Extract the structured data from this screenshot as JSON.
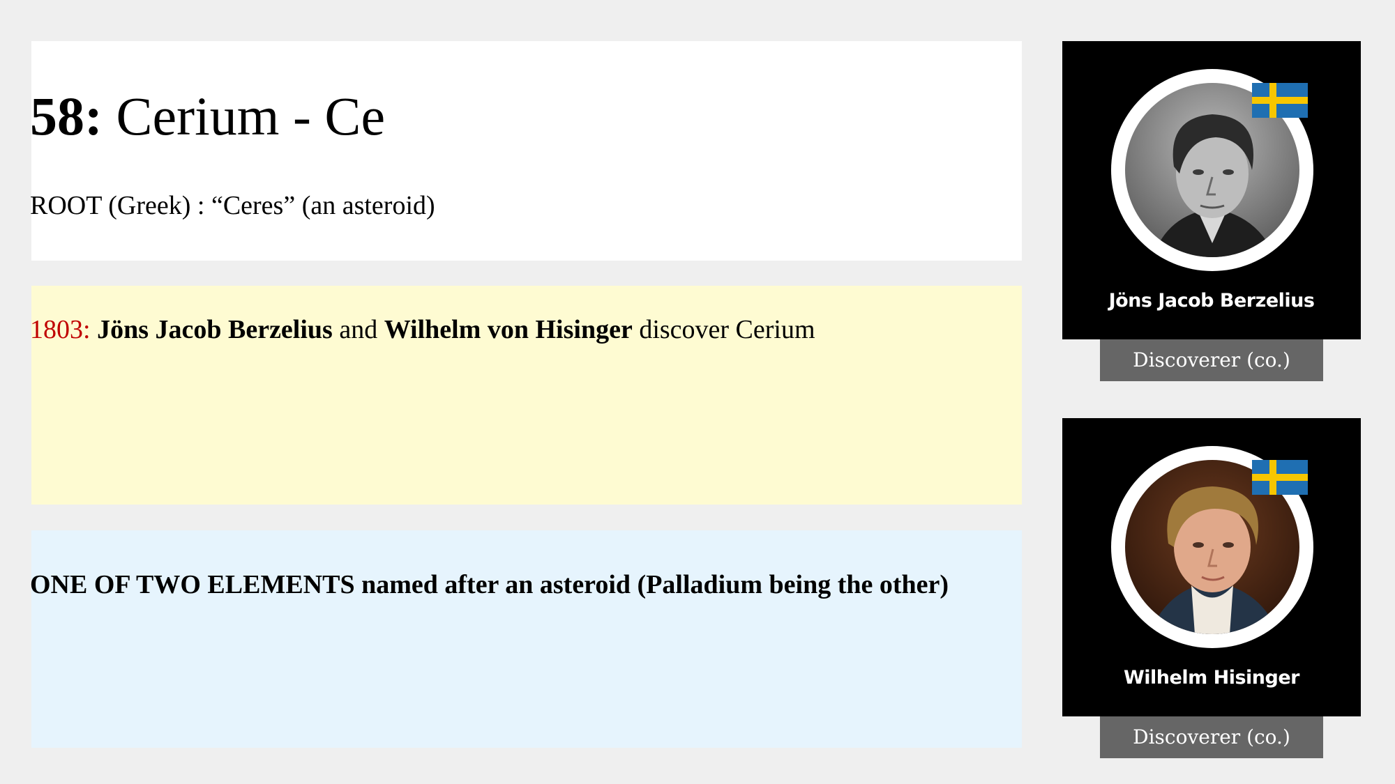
{
  "element": {
    "number_label": "58:",
    "name_symbol": "Cerium - Ce",
    "root": "ROOT (Greek) : “Ceres” (an asteroid)"
  },
  "discovery": {
    "year": "1803:",
    "discoverer_1": "Jöns Jacob Berzelius",
    "conjunction": "and",
    "discoverer_2": "Wilhelm von Hisinger",
    "action": "discover Cerium"
  },
  "fact": {
    "emphasis": "ONE OF TWO ELEMENTS",
    "text": "named after an asteroid (Palladium being the other)"
  },
  "discoverers": [
    {
      "name": "Jöns Jacob Berzelius",
      "role": "Discoverer (co.)",
      "flag_icon": "sweden-flag-icon"
    },
    {
      "name": "Wilhelm Hisinger",
      "role": "Discoverer (co.)",
      "flag_icon": "sweden-flag-icon"
    }
  ],
  "colors": {
    "year_red": "#c00000",
    "discovery_bg": "#fefbd2",
    "fact_bg": "#e6f4fd",
    "badge_gray": "#666666",
    "flag_blue": "#1f6fb2",
    "flag_yellow": "#f7c600"
  }
}
